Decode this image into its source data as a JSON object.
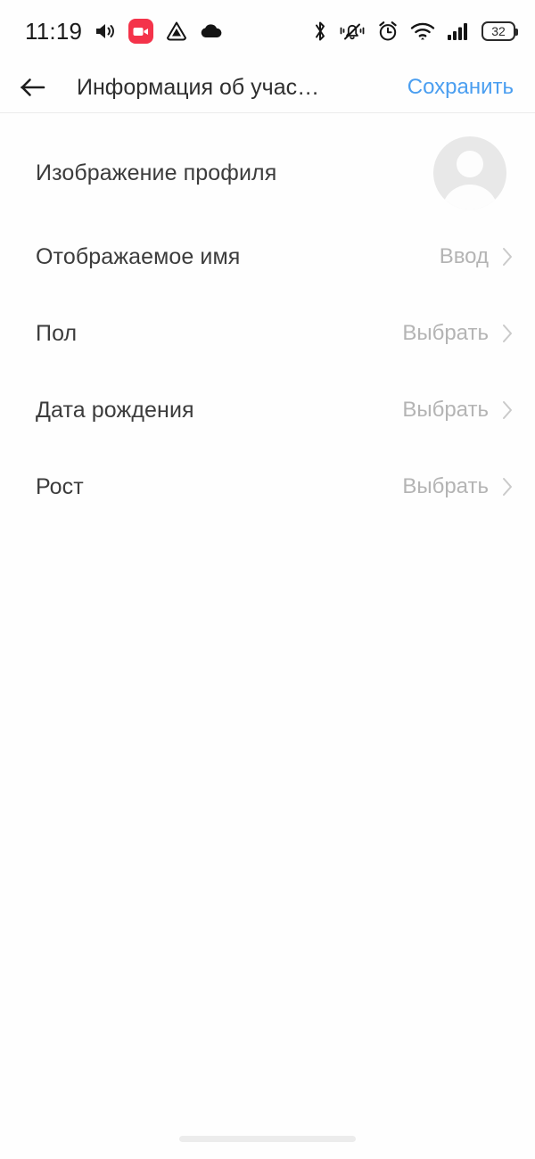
{
  "statusbar": {
    "time": "11:19",
    "battery_level": "32",
    "left_icons": [
      {
        "name": "volume-icon"
      },
      {
        "name": "screen-recording-icon"
      },
      {
        "name": "app-triangle-icon"
      },
      {
        "name": "cloud-icon"
      }
    ],
    "right_icons": [
      {
        "name": "bluetooth-icon"
      },
      {
        "name": "vibrate-mute-icon"
      },
      {
        "name": "alarm-clock-icon"
      },
      {
        "name": "wifi-icon"
      },
      {
        "name": "cellular-signal-icon"
      },
      {
        "name": "battery-icon"
      }
    ]
  },
  "appbar": {
    "back_icon": "arrow-left-icon",
    "title": "Информация об учас…",
    "save_label": "Сохранить",
    "save_color": "#4a9ef0"
  },
  "list": {
    "rows": [
      {
        "label": "Изображение профиля",
        "value": "",
        "control": "avatar",
        "name": "row-profile-picture"
      },
      {
        "label": "Отображаемое имя",
        "value": "Ввод",
        "control": "chevron",
        "name": "row-display-name"
      },
      {
        "label": "Пол",
        "value": "Выбрать",
        "control": "chevron",
        "name": "row-gender"
      },
      {
        "label": "Дата рождения",
        "value": "Выбрать",
        "control": "chevron",
        "name": "row-birth-date"
      },
      {
        "label": "Рост",
        "value": "Выбрать",
        "control": "chevron",
        "name": "row-height"
      }
    ]
  },
  "colors": {
    "background": "#fefefe",
    "label": "#3c3c3c",
    "placeholder": "#b4b4b4",
    "accent": "#4a9ef0",
    "divider": "#ebebeb",
    "avatar_bg": "#e8e8e8",
    "record_badge": "#f4334a"
  },
  "bottom": {
    "home_indicator": "home-indicator"
  }
}
